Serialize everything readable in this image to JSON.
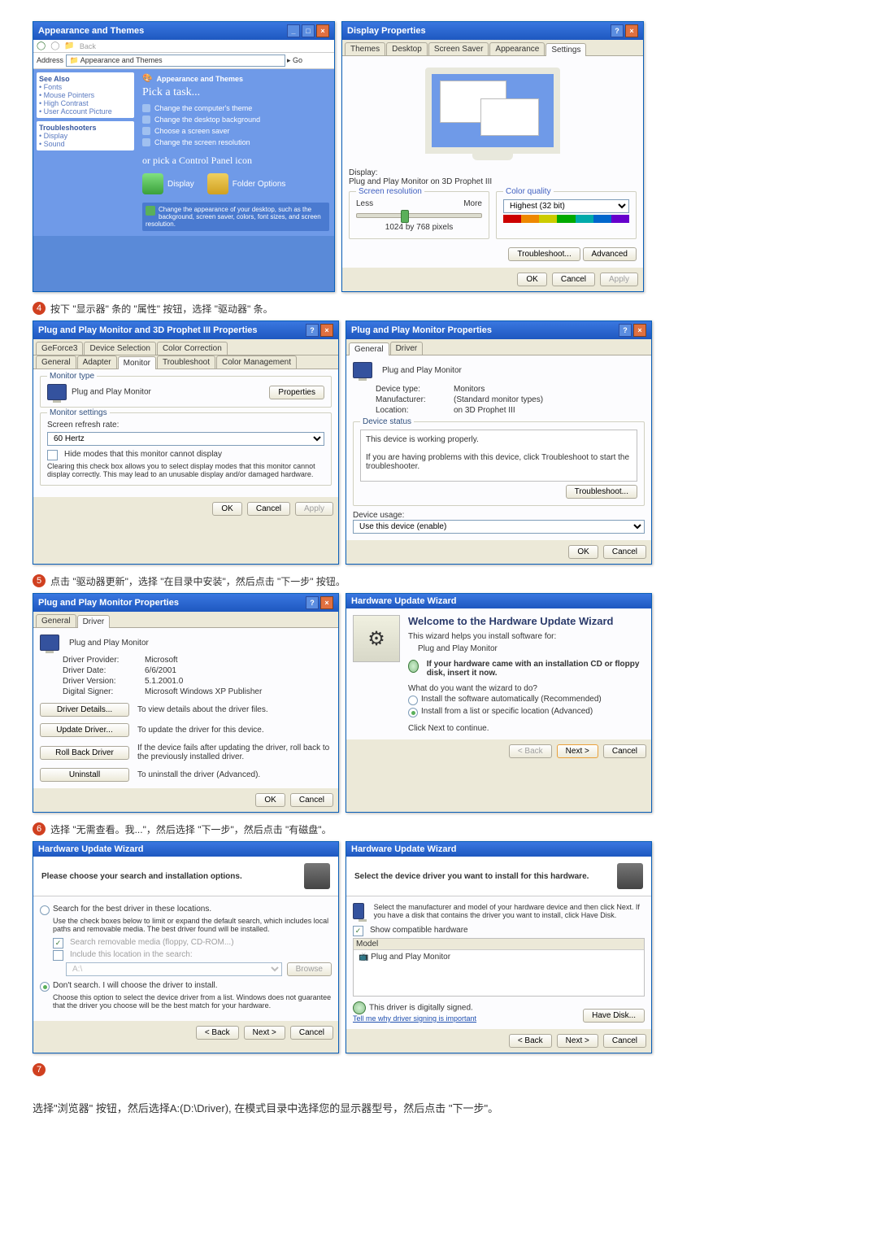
{
  "top": {
    "app_title": "Appearance and Themes",
    "back": "Back",
    "addr": "Appearance and Themes",
    "side": {
      "seealso": "See Also",
      "see_items": [
        "Fonts",
        "Mouse Pointers",
        "High Contrast",
        "User Account Picture"
      ],
      "trouble": "Troubleshooters",
      "t_items": [
        "Display",
        "Sound"
      ]
    },
    "task": {
      "subtitle": "Appearance and Themes",
      "pick": "Pick a task...",
      "t1": "Change the computer's theme",
      "t2": "Change the desktop background",
      "t3": "Choose a screen saver",
      "t4": "Change the screen resolution",
      "or": "or pick a Control Panel icon",
      "ic1": "Display",
      "ic2": "Folder Options",
      "note": "Change the appearance of your desktop, such as the background, screen saver, colors, font sizes, and screen resolution."
    },
    "disp": {
      "title": "Display Properties",
      "tabs": [
        "Themes",
        "Desktop",
        "Screen Saver",
        "Appearance",
        "Settings"
      ],
      "display_lbl": "Display:",
      "display_val": "Plug and Play Monitor on 3D Prophet III",
      "res_lbl": "Screen resolution",
      "less": "Less",
      "more": "More",
      "res_val": "1024 by 768 pixels",
      "color_lbl": "Color quality",
      "color_val": "Highest (32 bit)",
      "trouble": "Troubleshoot...",
      "adv": "Advanced",
      "ok": "OK",
      "cancel": "Cancel",
      "apply": "Apply"
    }
  },
  "step4": {
    "label": "按下 \"显示器\" 条的 \"属性\" 按钮，选择 \"驱动器\" 条。",
    "left": {
      "title": "Plug and Play Monitor and 3D Prophet III Properties",
      "tabs_top": [
        "GeForce3",
        "Device Selection",
        "Color Correction"
      ],
      "tabs_bot": [
        "General",
        "Adapter",
        "Monitor",
        "Troubleshoot",
        "Color Management"
      ],
      "montype": "Monitor type",
      "monname": "Plug and Play Monitor",
      "properties": "Properties",
      "settings": "Monitor settings",
      "refresh": "Screen refresh rate:",
      "hz": "60 Hertz",
      "hide": "Hide modes that this monitor cannot display",
      "warn": "Clearing this check box allows you to select display modes that this monitor cannot display correctly. This may lead to an unusable display and/or damaged hardware.",
      "ok": "OK",
      "cancel": "Cancel",
      "apply": "Apply"
    },
    "right": {
      "title": "Plug and Play Monitor Properties",
      "tabs": [
        "General",
        "Driver"
      ],
      "monname": "Plug and Play Monitor",
      "dt": "Device type:",
      "dtv": "Monitors",
      "mf": "Manufacturer:",
      "mfv": "(Standard monitor types)",
      "loc": "Location:",
      "locv": "on 3D Prophet III",
      "ds": "Device status",
      "ds1": "This device is working properly.",
      "ds2": "If you are having problems with this device, click Troubleshoot to start the troubleshooter.",
      "tbtn": "Troubleshoot...",
      "du": "Device usage:",
      "duv": "Use this device (enable)",
      "ok": "OK",
      "cancel": "Cancel"
    }
  },
  "step5": {
    "label": "点击 \"驱动器更新\"，选择 \"在目录中安装\"，然后点击 \"下一步\" 按钮。",
    "left": {
      "title": "Plug and Play Monitor Properties",
      "tabs": [
        "General",
        "Driver"
      ],
      "monname": "Plug and Play Monitor",
      "dp": "Driver Provider:",
      "dpv": "Microsoft",
      "dd": "Driver Date:",
      "ddv": "6/6/2001",
      "dv": "Driver Version:",
      "dvv": "5.1.2001.0",
      "ds": "Digital Signer:",
      "dsv": "Microsoft Windows XP Publisher",
      "b1": "Driver Details...",
      "b1d": "To view details about the driver files.",
      "b2": "Update Driver...",
      "b2d": "To update the driver for this device.",
      "b3": "Roll Back Driver",
      "b3d": "If the device fails after updating the driver, roll back to the previously installed driver.",
      "b4": "Uninstall",
      "b4d": "To uninstall the driver (Advanced).",
      "ok": "OK",
      "cancel": "Cancel"
    },
    "right": {
      "title": "Hardware Update Wizard",
      "h1": "Welcome to the Hardware Update Wizard",
      "t1": "This wizard helps you install software for:",
      "dev": "Plug and Play Monitor",
      "cd": "If your hardware came with an installation CD or floppy disk, insert it now.",
      "q": "What do you want the wizard to do?",
      "r1": "Install the software automatically (Recommended)",
      "r2": "Install from a list or specific location (Advanced)",
      "cont": "Click Next to continue.",
      "back": "< Back",
      "next": "Next >",
      "cancel": "Cancel"
    }
  },
  "step6": {
    "label": "选择 \"无需查看。我...\"，然后选择 \"下一步\"，然后点击 \"有磁盘\"。",
    "left": {
      "title": "Hardware Update Wizard",
      "head": "Please choose your search and installation options.",
      "r1": "Search for the best driver in these locations.",
      "r1d": "Use the check boxes below to limit or expand the default search, which includes local paths and removable media. The best driver found will be installed.",
      "c1": "Search removable media (floppy, CD-ROM...)",
      "c2": "Include this location in the search:",
      "path": "A:\\",
      "browse": "Browse",
      "r2": "Don't search. I will choose the driver to install.",
      "r2d": "Choose this option to select the device driver from a list. Windows does not guarantee that the driver you choose will be the best match for your hardware.",
      "back": "< Back",
      "next": "Next >",
      "cancel": "Cancel"
    },
    "right": {
      "title": "Hardware Update Wizard",
      "head": "Select the device driver you want to install for this hardware.",
      "sub": "Select the manufacturer and model of your hardware device and then click Next. If you have a disk that contains the driver you want to install, click Have Disk.",
      "show": "Show compatible hardware",
      "model": "Model",
      "item": "Plug and Play Monitor",
      "signed": "This driver is digitally signed.",
      "why": "Tell me why driver signing is important",
      "have": "Have Disk...",
      "back": "< Back",
      "next": "Next >",
      "cancel": "Cancel"
    }
  },
  "footer": "选择\"浏览器\" 按钮，然后选择A:(D:\\Driver), 在模式目录中选择您的显示器型号，然后点击 \"下一步\"。"
}
